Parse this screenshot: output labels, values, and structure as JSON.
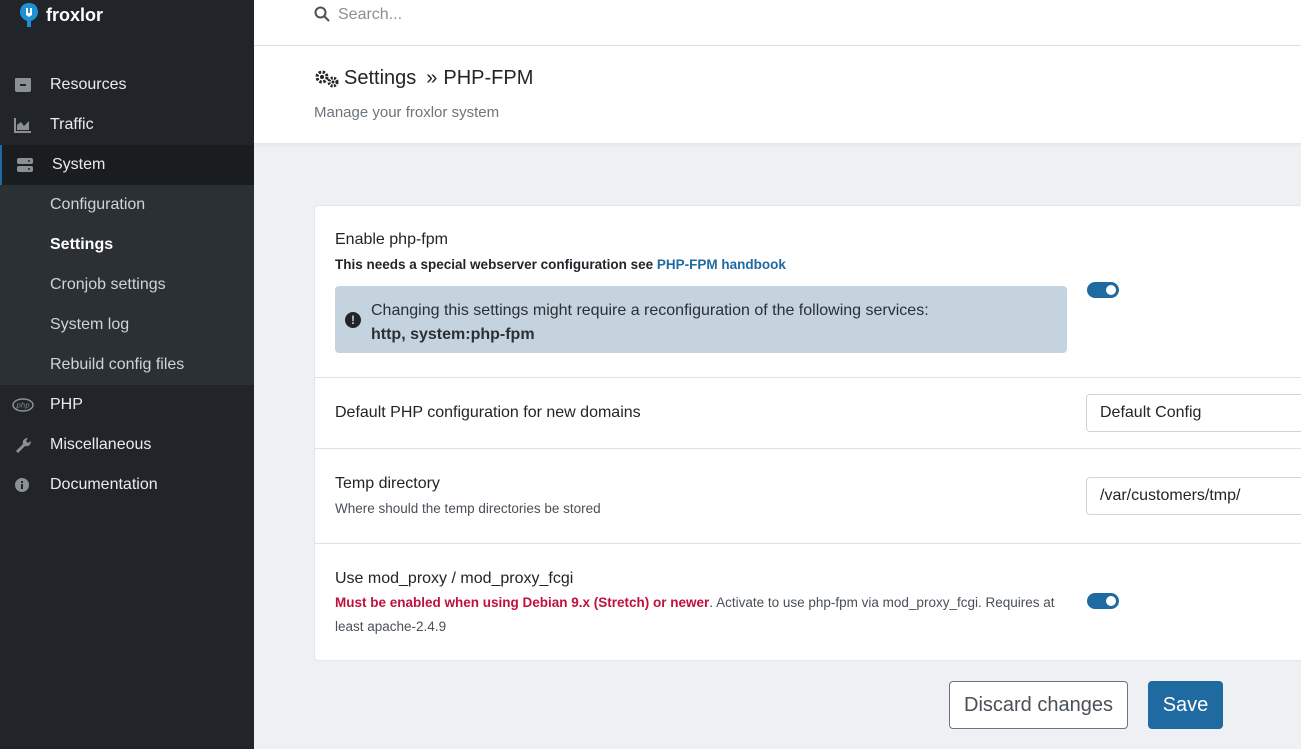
{
  "app": {
    "logo_text": "froxlor"
  },
  "search": {
    "placeholder": "Search..."
  },
  "sidebar": {
    "items": [
      {
        "label": "Resources"
      },
      {
        "label": "Traffic"
      },
      {
        "label": "System"
      },
      {
        "label": "PHP"
      },
      {
        "label": "Miscellaneous"
      },
      {
        "label": "Documentation"
      }
    ],
    "system_submenu": [
      {
        "label": "Configuration"
      },
      {
        "label": "Settings"
      },
      {
        "label": "Cronjob settings"
      },
      {
        "label": "System log"
      },
      {
        "label": "Rebuild config files"
      }
    ]
  },
  "header": {
    "title": "Settings",
    "separator": "»",
    "section": "PHP-FPM",
    "subtitle": "Manage your froxlor system"
  },
  "settings": {
    "fpm": {
      "title": "Enable php-fpm",
      "desc_prefix": "This needs a special webserver configuration see",
      "link": "PHP-FPM handbook",
      "alert_line1": "Changing this settings might require a reconfiguration of the following services:",
      "alert_services": "http, system:php-fpm",
      "enabled": true
    },
    "default_config": {
      "title": "Default PHP configuration for new domains",
      "value": "Default Config"
    },
    "tmpdir": {
      "title": "Temp directory",
      "desc": "Where should the temp directories be stored",
      "value": "/var/customers/tmp/"
    },
    "mod_proxy": {
      "title": "Use mod_proxy / mod_proxy_fcgi",
      "warn": "Must be enabled when using Debian 9.x (Stretch) or newer",
      "desc_line1": ". Activate to use php-fpm via mod_proxy_fcgi. Requires at",
      "desc_line2": "least apache-2.4.9",
      "enabled": true
    }
  },
  "buttons": {
    "discard": "Discard changes",
    "save": "Save"
  },
  "colors": {
    "accent": "#1f6aa0",
    "sidebar": "#212529",
    "warning": "#c0103c",
    "alert_bg": "#c5d3de"
  }
}
